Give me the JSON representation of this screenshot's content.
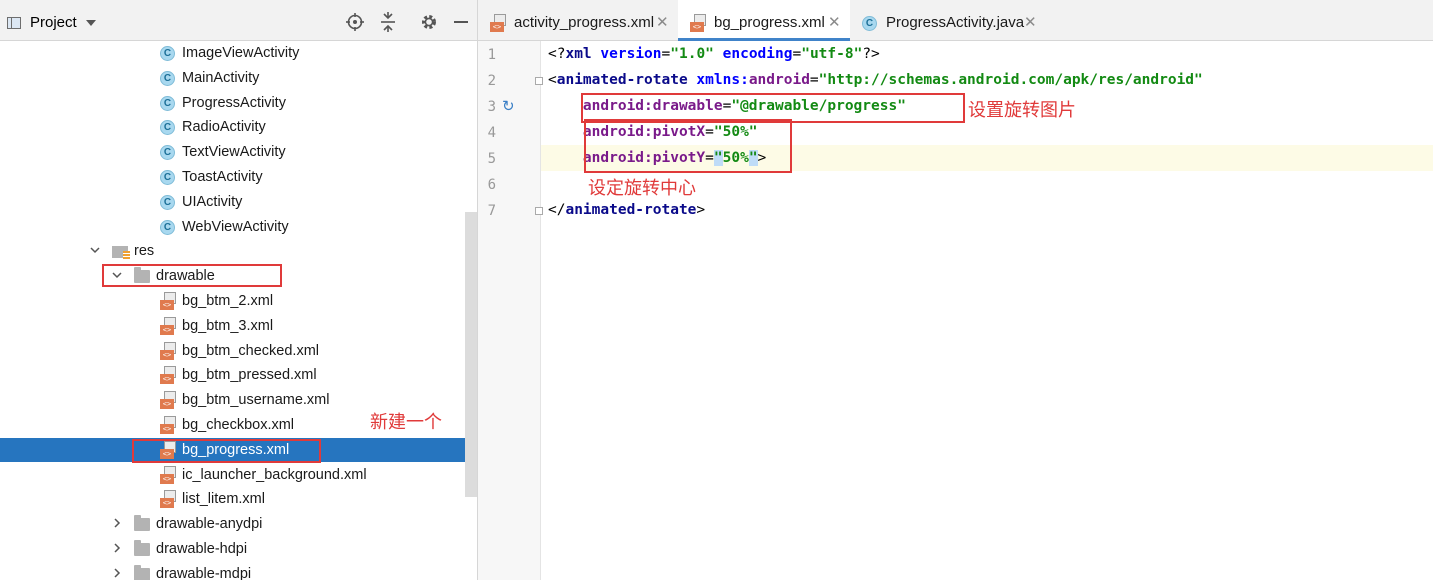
{
  "project_panel": {
    "title": "Project",
    "header_icons": [
      "locate-icon",
      "collapse-all-icon",
      "settings-icon",
      "minimize-icon"
    ],
    "tree": [
      {
        "label": "ImageViewActivity",
        "kind": "class",
        "indent": 3
      },
      {
        "label": "MainActivity",
        "kind": "class",
        "indent": 3
      },
      {
        "label": "ProgressActivity",
        "kind": "class",
        "indent": 3
      },
      {
        "label": "RadioActivity",
        "kind": "class",
        "indent": 3
      },
      {
        "label": "TextViewActivity",
        "kind": "class",
        "indent": 3
      },
      {
        "label": "ToastActivity",
        "kind": "class",
        "indent": 3
      },
      {
        "label": "UIActivity",
        "kind": "class",
        "indent": 3
      },
      {
        "label": "WebViewActivity",
        "kind": "class",
        "indent": 3
      },
      {
        "label": "res",
        "kind": "res-folder",
        "indent": 1,
        "expanded": true
      },
      {
        "label": "drawable",
        "kind": "folder",
        "indent": 2,
        "expanded": true
      },
      {
        "label": "bg_btm_2.xml",
        "kind": "xml",
        "indent": 3
      },
      {
        "label": "bg_btm_3.xml",
        "kind": "xml",
        "indent": 3
      },
      {
        "label": "bg_btm_checked.xml",
        "kind": "xml",
        "indent": 3
      },
      {
        "label": "bg_btm_pressed.xml",
        "kind": "xml",
        "indent": 3
      },
      {
        "label": "bg_btm_username.xml",
        "kind": "xml",
        "indent": 3
      },
      {
        "label": "bg_checkbox.xml",
        "kind": "xml",
        "indent": 3
      },
      {
        "label": "bg_progress.xml",
        "kind": "xml",
        "indent": 3,
        "selected": true
      },
      {
        "label": "ic_launcher_background.xml",
        "kind": "xml",
        "indent": 3
      },
      {
        "label": "list_litem.xml",
        "kind": "xml",
        "indent": 3
      },
      {
        "label": "drawable-anydpi",
        "kind": "folder",
        "indent": 2,
        "expanded": false
      },
      {
        "label": "drawable-hdpi",
        "kind": "folder",
        "indent": 2,
        "expanded": false
      },
      {
        "label": "drawable-mdpi",
        "kind": "folder",
        "indent": 2,
        "expanded": false
      }
    ],
    "annotation_new": "新建一个"
  },
  "editor": {
    "tabs": [
      {
        "label": "activity_progress.xml",
        "icon": "xml-file-icon",
        "active": false
      },
      {
        "label": "bg_progress.xml",
        "icon": "xml-file-icon",
        "active": true
      },
      {
        "label": "ProgressActivity.java",
        "icon": "java-class-icon",
        "active": false
      }
    ],
    "line_numbers": [
      "1",
      "2",
      "3",
      "4",
      "5",
      "6",
      "7"
    ],
    "code": [
      [
        [
          "pun",
          "<?"
        ],
        [
          "tag",
          "xml"
        ],
        [
          "pun",
          " "
        ],
        [
          "attr",
          "version"
        ],
        [
          "pun",
          "="
        ],
        [
          "val",
          "\"1.0\""
        ],
        [
          "pun",
          " "
        ],
        [
          "attr",
          "encoding"
        ],
        [
          "pun",
          "="
        ],
        [
          "val",
          "\"utf-8\""
        ],
        [
          "pun",
          "?>"
        ]
      ],
      [
        [
          "pun",
          "<"
        ],
        [
          "tag",
          "animated-rotate"
        ],
        [
          "pun",
          " "
        ],
        [
          "attr",
          "xmlns:"
        ],
        [
          "ns",
          "android"
        ],
        [
          "pun",
          "="
        ],
        [
          "val",
          "\"http://schemas.android.com/apk/res/android\""
        ]
      ],
      [
        [
          "pun",
          "    "
        ],
        [
          "ns",
          "android:drawable"
        ],
        [
          "pun",
          "="
        ],
        [
          "val",
          "\"@drawable/progress\""
        ]
      ],
      [
        [
          "pun",
          "    "
        ],
        [
          "ns",
          "android:pivotX"
        ],
        [
          "pun",
          "="
        ],
        [
          "val",
          "\"50%\""
        ]
      ],
      [
        [
          "pun",
          "    "
        ],
        [
          "ns",
          "android:pivotY"
        ],
        [
          "pun",
          "="
        ],
        [
          "sel",
          "\""
        ],
        [
          "val",
          "50%"
        ],
        [
          "sel",
          "\""
        ],
        [
          "pun",
          ">"
        ]
      ],
      [],
      [
        [
          "pun",
          "</"
        ],
        [
          "tag",
          "animated-rotate"
        ],
        [
          "pun",
          ">"
        ]
      ]
    ],
    "annotation_rotate_image": "设置旋转图片",
    "annotation_rotate_center": "设定旋转中心"
  },
  "colors": {
    "selection": "#2675bf",
    "annotation_red": "#e03a3a",
    "xml_value": "#138a13",
    "xml_namespace": "#7a1a8a"
  }
}
